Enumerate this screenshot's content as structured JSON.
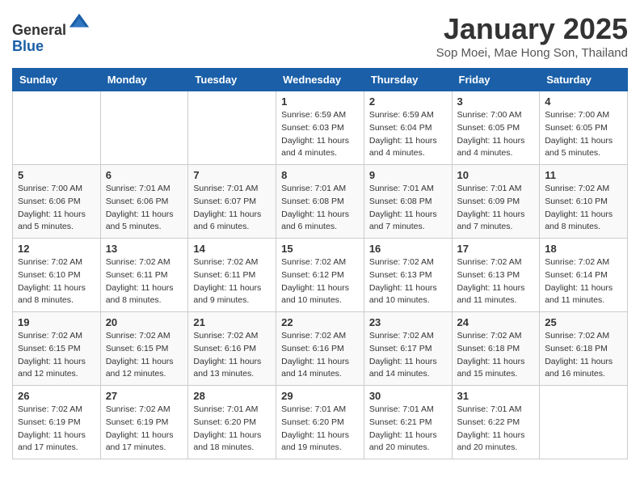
{
  "header": {
    "logo_line1": "General",
    "logo_line2": "Blue",
    "month": "January 2025",
    "location": "Sop Moei, Mae Hong Son, Thailand"
  },
  "weekdays": [
    "Sunday",
    "Monday",
    "Tuesday",
    "Wednesday",
    "Thursday",
    "Friday",
    "Saturday"
  ],
  "weeks": [
    [
      {
        "day": "",
        "info": ""
      },
      {
        "day": "",
        "info": ""
      },
      {
        "day": "",
        "info": ""
      },
      {
        "day": "1",
        "info": "Sunrise: 6:59 AM\nSunset: 6:03 PM\nDaylight: 11 hours\nand 4 minutes."
      },
      {
        "day": "2",
        "info": "Sunrise: 6:59 AM\nSunset: 6:04 PM\nDaylight: 11 hours\nand 4 minutes."
      },
      {
        "day": "3",
        "info": "Sunrise: 7:00 AM\nSunset: 6:05 PM\nDaylight: 11 hours\nand 4 minutes."
      },
      {
        "day": "4",
        "info": "Sunrise: 7:00 AM\nSunset: 6:05 PM\nDaylight: 11 hours\nand 5 minutes."
      }
    ],
    [
      {
        "day": "5",
        "info": "Sunrise: 7:00 AM\nSunset: 6:06 PM\nDaylight: 11 hours\nand 5 minutes."
      },
      {
        "day": "6",
        "info": "Sunrise: 7:01 AM\nSunset: 6:06 PM\nDaylight: 11 hours\nand 5 minutes."
      },
      {
        "day": "7",
        "info": "Sunrise: 7:01 AM\nSunset: 6:07 PM\nDaylight: 11 hours\nand 6 minutes."
      },
      {
        "day": "8",
        "info": "Sunrise: 7:01 AM\nSunset: 6:08 PM\nDaylight: 11 hours\nand 6 minutes."
      },
      {
        "day": "9",
        "info": "Sunrise: 7:01 AM\nSunset: 6:08 PM\nDaylight: 11 hours\nand 7 minutes."
      },
      {
        "day": "10",
        "info": "Sunrise: 7:01 AM\nSunset: 6:09 PM\nDaylight: 11 hours\nand 7 minutes."
      },
      {
        "day": "11",
        "info": "Sunrise: 7:02 AM\nSunset: 6:10 PM\nDaylight: 11 hours\nand 8 minutes."
      }
    ],
    [
      {
        "day": "12",
        "info": "Sunrise: 7:02 AM\nSunset: 6:10 PM\nDaylight: 11 hours\nand 8 minutes."
      },
      {
        "day": "13",
        "info": "Sunrise: 7:02 AM\nSunset: 6:11 PM\nDaylight: 11 hours\nand 8 minutes."
      },
      {
        "day": "14",
        "info": "Sunrise: 7:02 AM\nSunset: 6:11 PM\nDaylight: 11 hours\nand 9 minutes."
      },
      {
        "day": "15",
        "info": "Sunrise: 7:02 AM\nSunset: 6:12 PM\nDaylight: 11 hours\nand 10 minutes."
      },
      {
        "day": "16",
        "info": "Sunrise: 7:02 AM\nSunset: 6:13 PM\nDaylight: 11 hours\nand 10 minutes."
      },
      {
        "day": "17",
        "info": "Sunrise: 7:02 AM\nSunset: 6:13 PM\nDaylight: 11 hours\nand 11 minutes."
      },
      {
        "day": "18",
        "info": "Sunrise: 7:02 AM\nSunset: 6:14 PM\nDaylight: 11 hours\nand 11 minutes."
      }
    ],
    [
      {
        "day": "19",
        "info": "Sunrise: 7:02 AM\nSunset: 6:15 PM\nDaylight: 11 hours\nand 12 minutes."
      },
      {
        "day": "20",
        "info": "Sunrise: 7:02 AM\nSunset: 6:15 PM\nDaylight: 11 hours\nand 12 minutes."
      },
      {
        "day": "21",
        "info": "Sunrise: 7:02 AM\nSunset: 6:16 PM\nDaylight: 11 hours\nand 13 minutes."
      },
      {
        "day": "22",
        "info": "Sunrise: 7:02 AM\nSunset: 6:16 PM\nDaylight: 11 hours\nand 14 minutes."
      },
      {
        "day": "23",
        "info": "Sunrise: 7:02 AM\nSunset: 6:17 PM\nDaylight: 11 hours\nand 14 minutes."
      },
      {
        "day": "24",
        "info": "Sunrise: 7:02 AM\nSunset: 6:18 PM\nDaylight: 11 hours\nand 15 minutes."
      },
      {
        "day": "25",
        "info": "Sunrise: 7:02 AM\nSunset: 6:18 PM\nDaylight: 11 hours\nand 16 minutes."
      }
    ],
    [
      {
        "day": "26",
        "info": "Sunrise: 7:02 AM\nSunset: 6:19 PM\nDaylight: 11 hours\nand 17 minutes."
      },
      {
        "day": "27",
        "info": "Sunrise: 7:02 AM\nSunset: 6:19 PM\nDaylight: 11 hours\nand 17 minutes."
      },
      {
        "day": "28",
        "info": "Sunrise: 7:01 AM\nSunset: 6:20 PM\nDaylight: 11 hours\nand 18 minutes."
      },
      {
        "day": "29",
        "info": "Sunrise: 7:01 AM\nSunset: 6:20 PM\nDaylight: 11 hours\nand 19 minutes."
      },
      {
        "day": "30",
        "info": "Sunrise: 7:01 AM\nSunset: 6:21 PM\nDaylight: 11 hours\nand 20 minutes."
      },
      {
        "day": "31",
        "info": "Sunrise: 7:01 AM\nSunset: 6:22 PM\nDaylight: 11 hours\nand 20 minutes."
      },
      {
        "day": "",
        "info": ""
      }
    ]
  ]
}
